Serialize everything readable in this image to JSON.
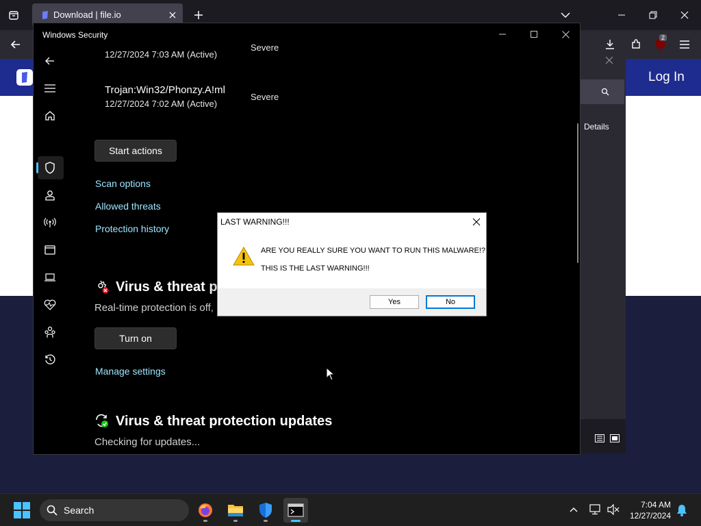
{
  "browser": {
    "tab_title": "Download | file.io",
    "login_label": "Log In",
    "panel_details_label": "Details",
    "extension_badge": "2"
  },
  "winsec": {
    "window_title": "Windows Security",
    "threats": [
      {
        "name": "",
        "date": "12/27/2024 7:03 AM (Active)",
        "severity": "Severe"
      },
      {
        "name": "Trojan:Win32/Phonzy.A!ml",
        "date": "12/27/2024 7:02 AM (Active)",
        "severity": "Severe"
      }
    ],
    "start_actions_label": "Start actions",
    "links": {
      "scan_options": "Scan options",
      "allowed_threats": "Allowed threats",
      "protection_history": "Protection history",
      "manage_settings": "Manage settings"
    },
    "settings_section": {
      "title": "Virus & threat pr",
      "subtitle": "Real-time protection is off,",
      "button_label": "Turn on"
    },
    "updates_section": {
      "title": "Virus & threat protection updates",
      "subtitle": "Checking for updates..."
    }
  },
  "dialog": {
    "title": "LAST WARNING!!!",
    "line1": "ARE YOU REALLY SURE YOU WANT TO RUN THIS MALWARE!?",
    "line2": "THIS IS THE LAST WARNING!!!",
    "yes_label": "Yes",
    "no_label": "No"
  },
  "taskbar": {
    "search_label": "Search",
    "time": "7:04 AM",
    "date": "12/27/2024"
  },
  "colors": {
    "accent": "#4cc2ff",
    "link": "#9ee6ff",
    "site_header": "#1e2b8f",
    "warning": "#f5c211"
  }
}
